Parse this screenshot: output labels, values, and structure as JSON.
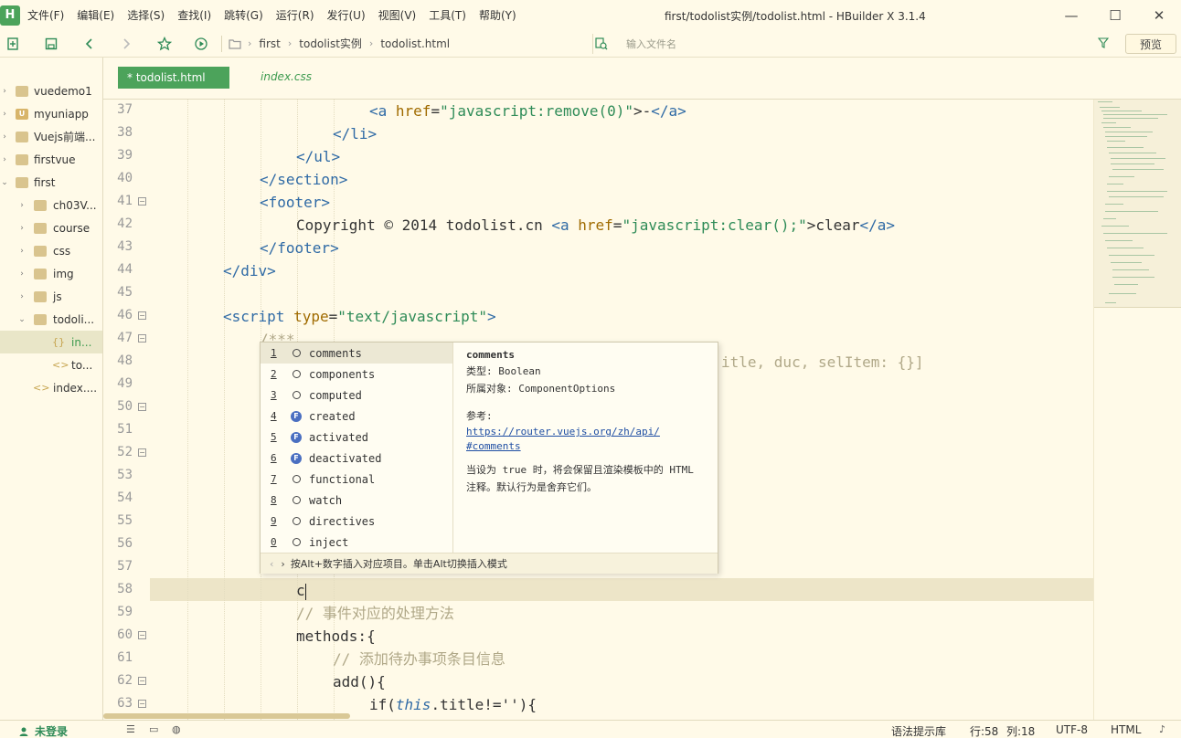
{
  "menubar": {
    "logo": "H",
    "items": [
      "文件(F)",
      "编辑(E)",
      "选择(S)",
      "查找(I)",
      "跳转(G)",
      "运行(R)",
      "发行(U)",
      "视图(V)",
      "工具(T)",
      "帮助(Y)"
    ],
    "window_title": "first/todolist实例/todolist.html - HBuilder X 3.1.4",
    "minimize": "—",
    "maximize": "☐",
    "close": "✕"
  },
  "toolbar": {
    "breadcrumb": [
      "first",
      "todolist实例",
      "todolist.html"
    ],
    "file_search_placeholder": "输入文件名",
    "preview_label": "预览"
  },
  "sidebar": {
    "items": [
      {
        "label": "vuedemo1",
        "type": "folder"
      },
      {
        "label": "myuniapp",
        "type": "u"
      },
      {
        "label": "Vuejs前端...",
        "type": "folder"
      },
      {
        "label": "firstvue",
        "type": "folder"
      },
      {
        "label": "first",
        "type": "folder-open"
      },
      {
        "label": "ch03V...",
        "type": "folder"
      },
      {
        "label": "course",
        "type": "folder"
      },
      {
        "label": "css",
        "type": "folder"
      },
      {
        "label": "img",
        "type": "folder"
      },
      {
        "label": "js",
        "type": "folder"
      },
      {
        "label": "todoli...",
        "type": "folder-open"
      },
      {
        "label": "in...",
        "type": "code"
      },
      {
        "label": "to...",
        "type": "code"
      },
      {
        "label": "index....",
        "type": "code"
      }
    ]
  },
  "tabs": {
    "active": "* todolist.html",
    "other": "index.css"
  },
  "editor": {
    "line_numbers": [
      "37",
      "38",
      "39",
      "40",
      "41",
      "42",
      "43",
      "44",
      "45",
      "46",
      "47",
      "48",
      "49",
      "50",
      "51",
      "52",
      "53",
      "54",
      "55",
      "56",
      "57",
      "58",
      "59",
      "60",
      "61",
      "62",
      "63"
    ],
    "code": {
      "l37": "<a href=\"javascript:remove(0)\">-</a>",
      "l37_tag_open": "<a",
      "l37_attr": "href",
      "l37_eq": "=",
      "l37_str": "\"javascript:remove(0)\"",
      "l37_text": ">-",
      "l37_tag_close": "</a>",
      "l38": "</li>",
      "l39": "</ul>",
      "l40": "</section>",
      "l41": "<footer>",
      "l42_text": "Copyright © 2014 todolist.cn ",
      "l42_a": "<a",
      "l42_attr": "href",
      "l42_eq": "=",
      "l42_str": "\"javascript:clear();\"",
      "l42_inner": ">clear",
      "l42_close": "</a>",
      "l43": "</footer>",
      "l44": "</div>",
      "l46_tag": "<script",
      "l46_attr": "type",
      "l46_eq": "=",
      "l46_str": "\"text/javascript\"",
      "l46_end": ">",
      "l47": "/***",
      "l48_tail": "itle, duc, selItem: {}]",
      "l58": "c",
      "l59": "// 事件对应的处理方法",
      "l60": "methods:{",
      "l61": "// 添加待办事项条目信息",
      "l62": "add(){",
      "l63_if": "if(",
      "l63_this": "this",
      "l63_rest": ".title!=''){"
    }
  },
  "autocomplete": {
    "items": [
      {
        "num": "1",
        "icon": "property",
        "label": "comments"
      },
      {
        "num": "2",
        "icon": "property",
        "label": "components"
      },
      {
        "num": "3",
        "icon": "property",
        "label": "computed"
      },
      {
        "num": "4",
        "icon": "function",
        "label": "created"
      },
      {
        "num": "5",
        "icon": "function",
        "label": "activated"
      },
      {
        "num": "6",
        "icon": "function",
        "label": "deactivated"
      },
      {
        "num": "7",
        "icon": "property",
        "label": "functional"
      },
      {
        "num": "8",
        "icon": "property",
        "label": "watch"
      },
      {
        "num": "9",
        "icon": "property",
        "label": "directives"
      },
      {
        "num": "0",
        "icon": "property",
        "label": "inject"
      }
    ],
    "detail": {
      "title": "comments",
      "type_line": "类型: Boolean",
      "owner_line": "所属对象: ComponentOptions",
      "ref_label": "参考:",
      "link_1": "https://router.vuejs.org/zh/api/",
      "link_2": "#comments",
      "desc": "当设为 true 时，将会保留且渲染模板中的 HTML 注释。默认行为是舍弃它们。"
    },
    "footer": "按Alt+数字插入对应项目。单击Alt切换插入模式"
  },
  "statusbar": {
    "login": "未登录",
    "lint": "语法提示库",
    "line": "行:58",
    "col": "列:18",
    "encoding": "UTF-8",
    "language": "HTML"
  }
}
